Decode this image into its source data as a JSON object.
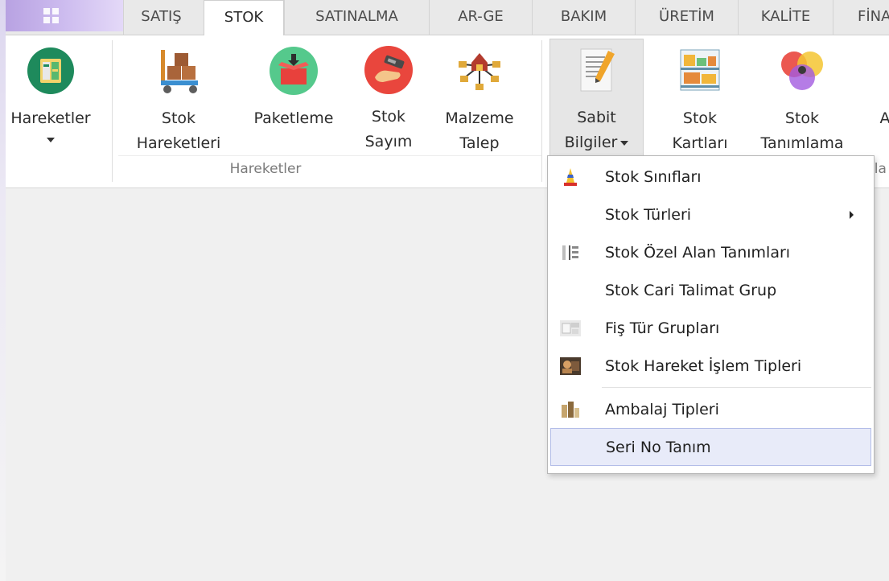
{
  "tabs": [
    {
      "label": "SATIŞ",
      "active": false
    },
    {
      "label": "STOK",
      "active": true
    },
    {
      "label": "SATINALMA",
      "active": false
    },
    {
      "label": "AR-GE",
      "active": false
    },
    {
      "label": "BAKIM",
      "active": false
    },
    {
      "label": "ÜRETİM",
      "active": false
    },
    {
      "label": "KALİTE",
      "active": false
    },
    {
      "label": "FİNA",
      "active": false
    }
  ],
  "ribbon": {
    "hareketler_btn": {
      "label": "Hareketler",
      "icon": "hareketler-icon"
    },
    "stok_hareketleri": {
      "line1": "Stok",
      "line2": "Hareketleri",
      "icon": "hand-truck-boxes-icon"
    },
    "paketleme": {
      "label": "Paketleme",
      "icon": "package-icon"
    },
    "stok_sayim": {
      "line1": "Stok",
      "line2": "Sayım",
      "icon": "hand-scanner-icon"
    },
    "malzeme_talep": {
      "line1": "Malzeme",
      "line2": "Talep",
      "icon": "warehouse-network-icon"
    },
    "sabit_bilgiler": {
      "line1": "Sabit",
      "line2": "Bilgiler",
      "icon": "document-pencil-icon"
    },
    "stok_kartlari": {
      "line1": "Stok",
      "line2": "Kartları",
      "icon": "shelf-icon"
    },
    "stok_tanimlama": {
      "line1": "Stok",
      "line2": "Tanımlama",
      "icon": "color-circles-icon"
    },
    "cut_off": {
      "label": "A"
    },
    "group_label": "Hareketler",
    "group_label_cut": "ıla"
  },
  "menu": {
    "items": [
      {
        "label": "Stok Sınıfları",
        "icon": "cone-icon"
      },
      {
        "label": "Stok Türleri",
        "icon": "",
        "submenu": true
      },
      {
        "label": "Stok Özel Alan Tanımları",
        "icon": "grid-fields-icon"
      },
      {
        "label": "Stok Cari Talimat Grup",
        "icon": ""
      },
      {
        "label": "Fiş Tür Grupları",
        "icon": "receipt-photo-icon"
      },
      {
        "label": "Stok Hareket İşlem Tipleri",
        "icon": "photo-icon"
      },
      {
        "label": "Ambalaj Tipleri",
        "icon": "box-stack-icon"
      },
      {
        "label": "Seri No Tanım",
        "icon": "",
        "highlighted": true
      }
    ]
  },
  "colors": {
    "accent_highlight": "#e8ebf9",
    "app_button": "#c7b4ec",
    "workspace": "#f0f0f0"
  }
}
